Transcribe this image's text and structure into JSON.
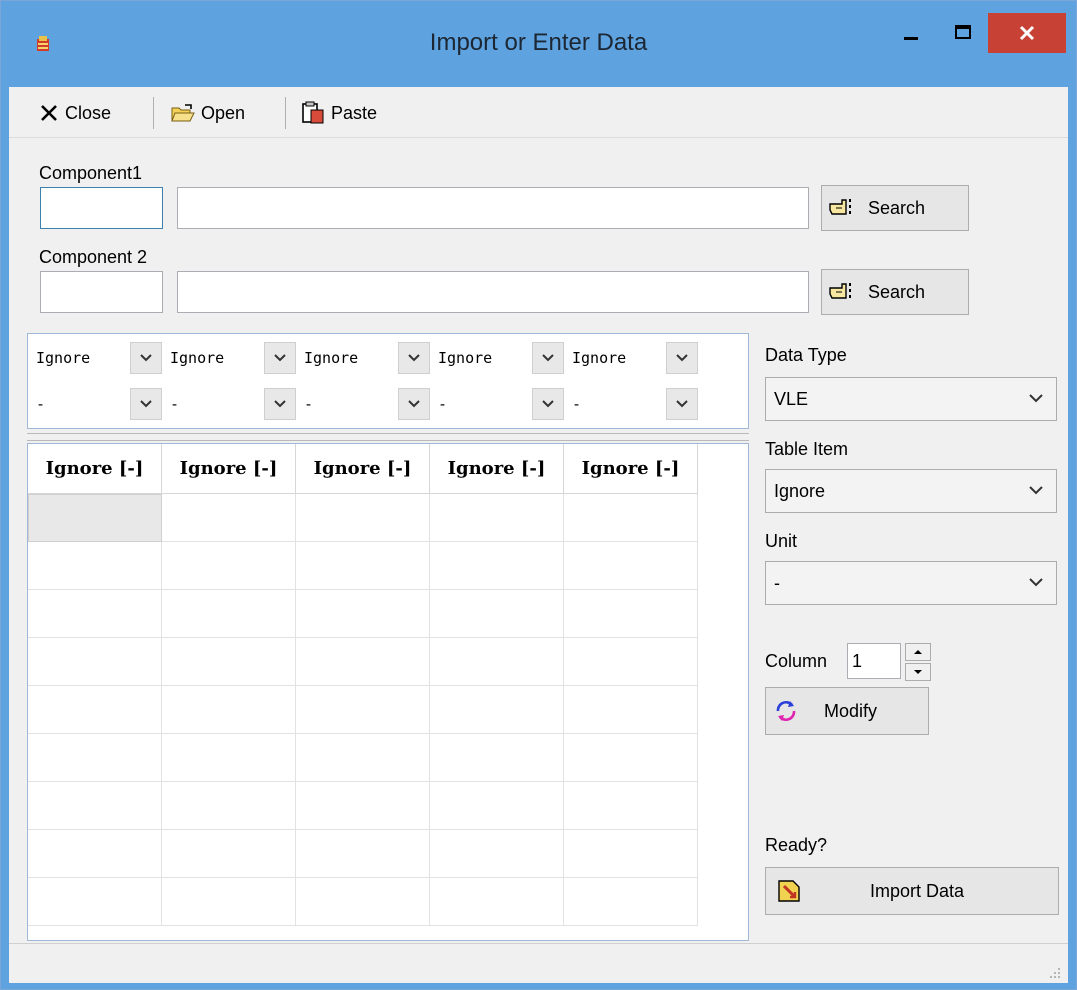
{
  "window": {
    "title": "Import or Enter Data"
  },
  "toolbar": {
    "close": "Close",
    "open": "Open",
    "paste": "Paste"
  },
  "component1": {
    "label": "Component1",
    "id_value": "",
    "name_value": "",
    "search": "Search"
  },
  "component2": {
    "label": "Component 2",
    "id_value": "",
    "name_value": "",
    "search": "Search"
  },
  "mapping": {
    "items": [
      "Ignore",
      "Ignore",
      "Ignore",
      "Ignore",
      "Ignore"
    ],
    "units": [
      "-",
      "-",
      "-",
      "-",
      "-"
    ]
  },
  "grid": {
    "headers": [
      "Ignore [-]",
      "Ignore [-]",
      "Ignore [-]",
      "Ignore [-]",
      "Ignore [-]"
    ]
  },
  "side": {
    "data_type_label": "Data Type",
    "data_type_value": "VLE",
    "table_item_label": "Table Item",
    "table_item_value": "Ignore",
    "unit_label": "Unit",
    "unit_value": "-",
    "column_label": "Column",
    "column_value": "1",
    "modify": "Modify",
    "ready_label": "Ready?",
    "import": "Import Data"
  },
  "colors": {
    "titlebar": "#5ea3e0",
    "close_button": "#c84135",
    "background": "#f0f0f0"
  },
  "icons": [
    "app-icon",
    "close-x-icon",
    "open-folder-icon",
    "paste-icon",
    "pointing-hand-icon",
    "refresh-icon",
    "import-icon",
    "chevron-down-icon",
    "resize-grip-icon"
  ]
}
